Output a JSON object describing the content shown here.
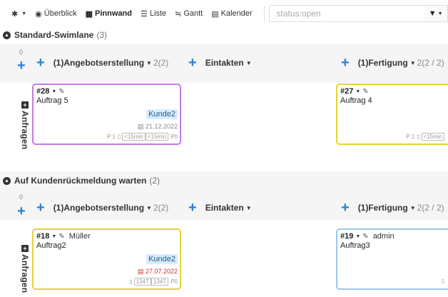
{
  "toolbar": {
    "settings_icon": "gear-icon",
    "overview": "Überblick",
    "board": "Pinnwand",
    "list": "Liste",
    "gantt": "Gantt",
    "calendar": "Kalender",
    "search_value": "status:open"
  },
  "colors": {
    "accent": "#2a7fd4",
    "purple": "#c878e8",
    "yellow": "#e3d23a",
    "blue": "#9cc6ec",
    "tag_bg": "#d6ecff",
    "overdue": "#c8332b"
  },
  "columns": {
    "c1": {
      "name": "(1)Angebotserstellung",
      "count": "2(2)"
    },
    "c2": {
      "name": "Eintakten"
    },
    "c3": {
      "name": "(1)Fertigung",
      "count": "2(2 / 2)"
    }
  },
  "lanes": [
    {
      "title": "Standard-Swimlane",
      "count": "(3)",
      "zero": "0",
      "row_label": "Anfragen",
      "cards": [
        {
          "id": "#28",
          "user": "",
          "title": "Auftrag 5",
          "tag": "Kunde2",
          "date": "21.12.2022",
          "meta_prefix": "P 1",
          "meta_a": "<15min",
          "meta_b": "<15min",
          "meta_p": "P0"
        },
        {
          "id": "#27",
          "user": "",
          "title": "Auftrag 4",
          "meta_prefix": "P 1",
          "meta_a": "<15min"
        }
      ]
    },
    {
      "title": "Auf Kundenrückmeldung warten",
      "count": "(2)",
      "zero": "0",
      "row_label": "Anfragen",
      "cards": [
        {
          "id": "#18",
          "user": "Müller",
          "title": "Auftrag2",
          "tag": "Kunde2",
          "date": "27.07.2022",
          "meta_a": "134T",
          "meta_b": "134T",
          "meta_p": "P0"
        },
        {
          "id": "#19",
          "user": "admin",
          "title": "Auftrag3"
        }
      ]
    }
  ]
}
